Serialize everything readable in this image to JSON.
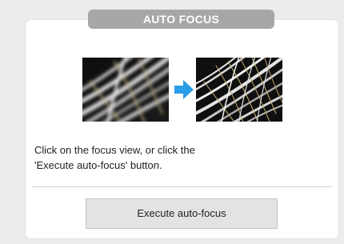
{
  "panel": {
    "title": "AUTO FOCUS"
  },
  "focus_images": {
    "before": "blurry-focus-view",
    "arrow": "right-arrow-icon",
    "after": "sharp-focus-view",
    "arrow_color": "#2a9de8"
  },
  "instructions": {
    "line1": "Click on the focus view, or click the",
    "line2": "'Execute auto-focus' button."
  },
  "actions": {
    "execute_label": "Execute auto-focus"
  },
  "colors": {
    "background": "#ececec",
    "panel": "#ffffff",
    "title_pill": "#a7a7a7",
    "button": "#e3e3e3"
  }
}
